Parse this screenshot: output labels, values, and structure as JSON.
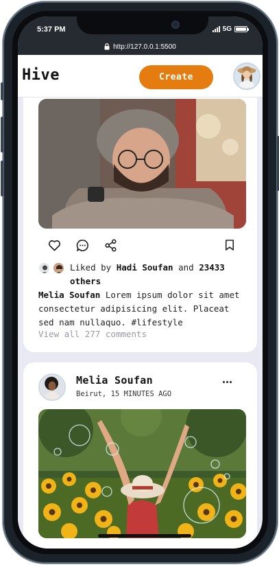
{
  "status": {
    "time": "5:37 PM",
    "network": "5G"
  },
  "browser": {
    "url": "http://127.0.0.1:5500"
  },
  "header": {
    "logo": "Hive",
    "create_label": "Create"
  },
  "icons": {
    "lock": "lock-icon",
    "like": "heart-icon",
    "comment": "comment-icon",
    "share": "share-icon",
    "bookmark": "bookmark-icon",
    "more": "more-icon"
  },
  "colors": {
    "accent": "#e47c10",
    "background": "#e9e9f4",
    "muted": "#9a9aa6"
  },
  "posts": [
    {
      "liked_prefix": "Liked by",
      "liked_by": "Hadi Soufan",
      "liked_and": "and",
      "liked_count": "23433",
      "liked_others": "others",
      "caption_author": "Melia Soufan",
      "caption_text": "Lorem ipsum dolor sit amet consectetur adipisicing elit. Placeat sed nam nullaquo. #lifestyle",
      "comments": "View all 277 comments"
    },
    {
      "author": "Melia Soufan",
      "meta": "Beirut, 15 MINUTES AGO"
    }
  ]
}
